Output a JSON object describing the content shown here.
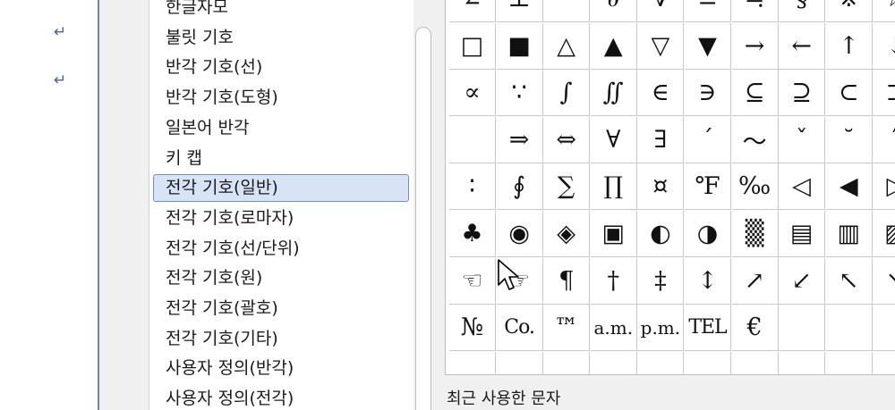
{
  "document": {
    "paragraph_marks": [
      "↵",
      "↵"
    ]
  },
  "category_list": {
    "items": [
      {
        "label": "한글자모",
        "selected": false
      },
      {
        "label": "불릿 기호",
        "selected": false
      },
      {
        "label": "반각 기호(선)",
        "selected": false
      },
      {
        "label": "반각 기호(도형)",
        "selected": false
      },
      {
        "label": "일본어 반각",
        "selected": false
      },
      {
        "label": "키 캡",
        "selected": false
      },
      {
        "label": "전각 기호(일반)",
        "selected": true
      },
      {
        "label": "전각 기호(로마자)",
        "selected": false
      },
      {
        "label": "전각 기호(선/단위)",
        "selected": false
      },
      {
        "label": "전각 기호(원)",
        "selected": false
      },
      {
        "label": "전각 기호(괄호)",
        "selected": false
      },
      {
        "label": "전각 기호(기타)",
        "selected": false
      },
      {
        "label": "사용자 정의(반각)",
        "selected": false
      },
      {
        "label": "사용자 정의(전각)",
        "selected": false
      }
    ]
  },
  "symbol_grid": {
    "rows": [
      [
        "∠",
        "⊥",
        "⌒",
        "∂",
        "∇",
        "≡",
        "≒",
        "§",
        "※",
        "☆"
      ],
      [
        "□",
        "■",
        "△",
        "▲",
        "▽",
        "▼",
        "→",
        "←",
        "↑",
        "↓"
      ],
      [
        "∝",
        "∵",
        "∫",
        "∬",
        "∈",
        "∋",
        "⊆",
        "⊇",
        "⊂",
        "⊃"
      ],
      [
        "",
        "⇒",
        "⇔",
        "∀",
        "∃",
        "´",
        "～",
        "ˇ",
        "˘",
        "˝"
      ],
      [
        "∶",
        "∮",
        "∑",
        "∏",
        "¤",
        "℉",
        "‰",
        "◁",
        "◀",
        "▷"
      ],
      [
        "♣",
        "◉",
        "◈",
        "▣",
        "◐",
        "◑",
        "▒",
        "▤",
        "▥",
        "▨"
      ],
      [
        "☜",
        "☞",
        "¶",
        "†",
        "‡",
        "↕",
        "↗",
        "↙",
        "↖",
        "↘"
      ],
      [
        "№",
        "Co.",
        "™",
        "a.m.",
        "p.m.",
        "TEL",
        "€",
        "",
        "",
        ""
      ],
      [
        "",
        "",
        "",
        "",
        "",
        "",
        "",
        "",
        "",
        ""
      ]
    ]
  },
  "recent": {
    "label": "최근 사용한 문자"
  }
}
